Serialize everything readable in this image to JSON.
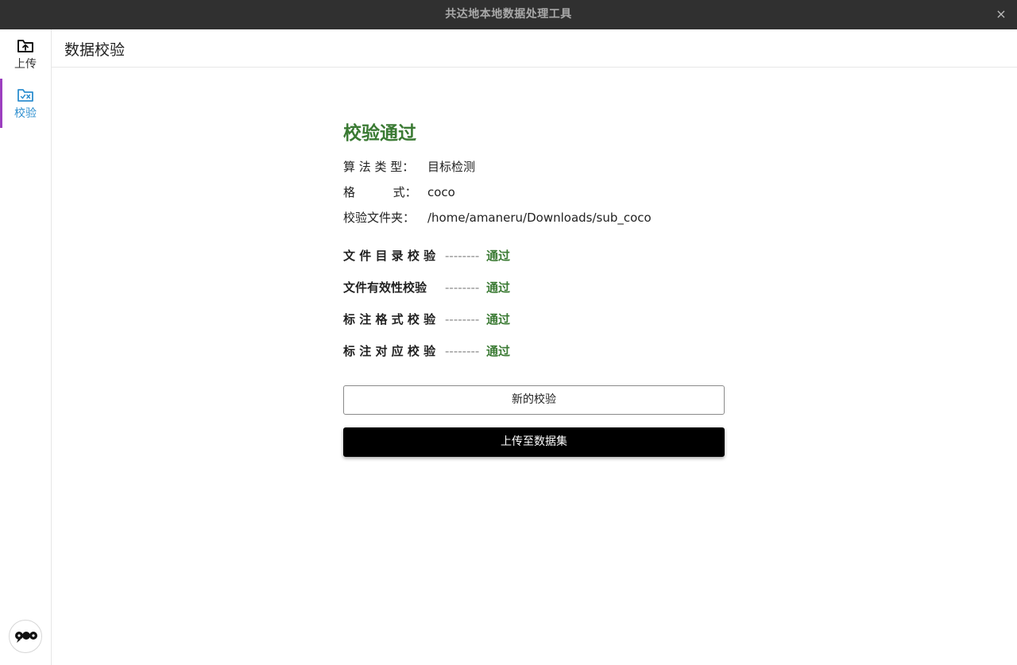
{
  "window": {
    "title": "共达地本地数据处理工具",
    "close_glyph": "×"
  },
  "sidebar": {
    "items": [
      {
        "label": "上传",
        "icon": "folder-upload-icon",
        "active": false
      },
      {
        "label": "校验",
        "icon": "folder-check-icon",
        "active": true
      }
    ],
    "accent_color": "#9c3fbf",
    "active_label_color": "#2e8fcf"
  },
  "header": {
    "title": "数据校验"
  },
  "result": {
    "title": "校验通过",
    "title_color": "#3a7a33",
    "info": [
      {
        "key": "算 法 类 型：",
        "value": "目标检测"
      },
      {
        "key": "格          式：",
        "value": "coco"
      },
      {
        "key": "校验文件夹：",
        "value": "/home/amaneru/Downloads/sub_coco"
      }
    ],
    "checks": [
      {
        "name": "文 件 目 录 校 验",
        "dash": "--------",
        "status": "通过"
      },
      {
        "name": "文件有效性校验",
        "dash": "--------",
        "status": "通过"
      },
      {
        "name": "标 注 格 式 校 验",
        "dash": "--------",
        "status": "通过"
      },
      {
        "name": "标 注 对 应 校 验",
        "dash": "--------",
        "status": "通过"
      }
    ]
  },
  "actions": {
    "new_check_label": "新的校验",
    "upload_label": "上传至数据集"
  }
}
